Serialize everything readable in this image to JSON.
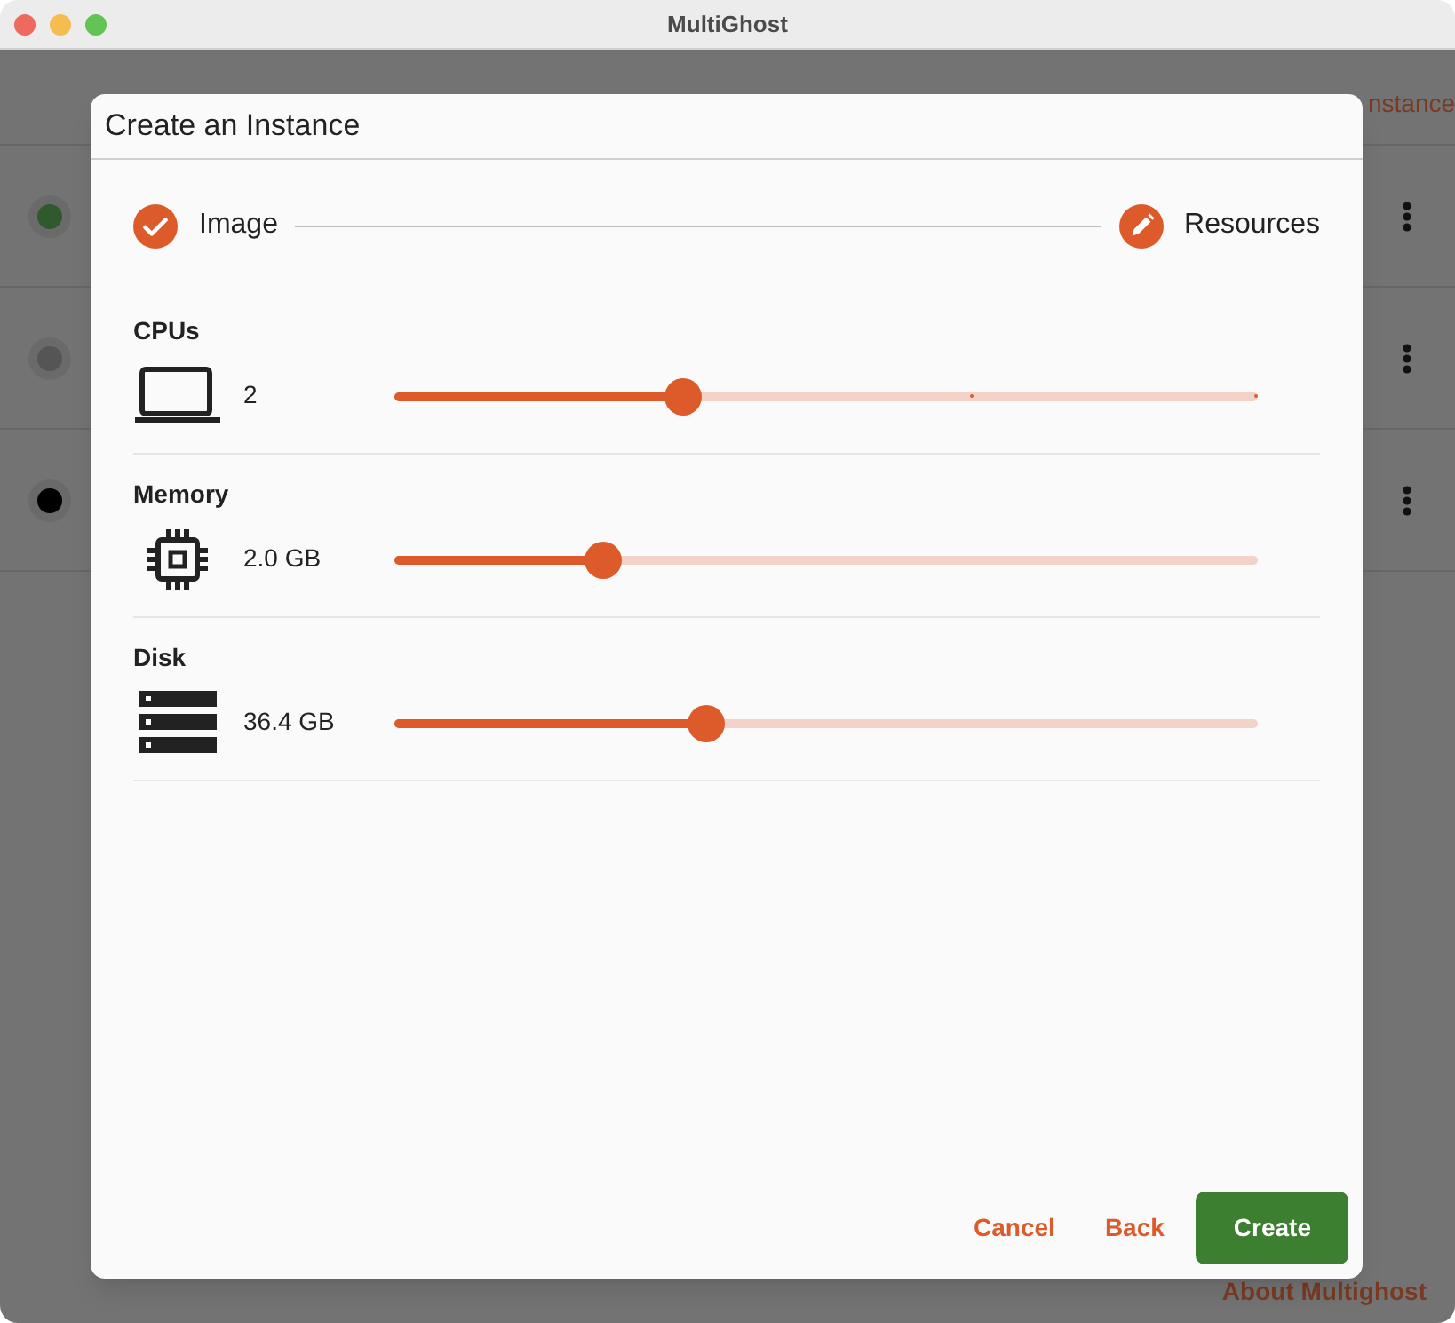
{
  "window": {
    "title": "MultiGhost"
  },
  "background": {
    "create_link": "nstance",
    "footer_link": "About Multighost",
    "instances": [
      {
        "color": "#2e5a2e"
      },
      {
        "color": "#555555"
      },
      {
        "color": "#000000"
      }
    ]
  },
  "dialog": {
    "title": "Create an Instance",
    "steps": [
      {
        "label": "Image",
        "kind": "done"
      },
      {
        "label": "Resources",
        "kind": "editing"
      }
    ],
    "resources": [
      {
        "label": "CPUs",
        "kind": "cpu",
        "value": "2",
        "level": 0.333,
        "ticks": true
      },
      {
        "label": "Memory",
        "kind": "memory",
        "value": "2.0 GB",
        "level": 0.24,
        "ticks": false
      },
      {
        "label": "Disk",
        "kind": "disk",
        "value": "36.4 GB",
        "level": 0.36,
        "ticks": false
      }
    ],
    "buttons": [
      {
        "label": "Cancel",
        "kind": "text"
      },
      {
        "label": "Back",
        "kind": "text"
      },
      {
        "label": "Create",
        "kind": "primary"
      }
    ]
  }
}
